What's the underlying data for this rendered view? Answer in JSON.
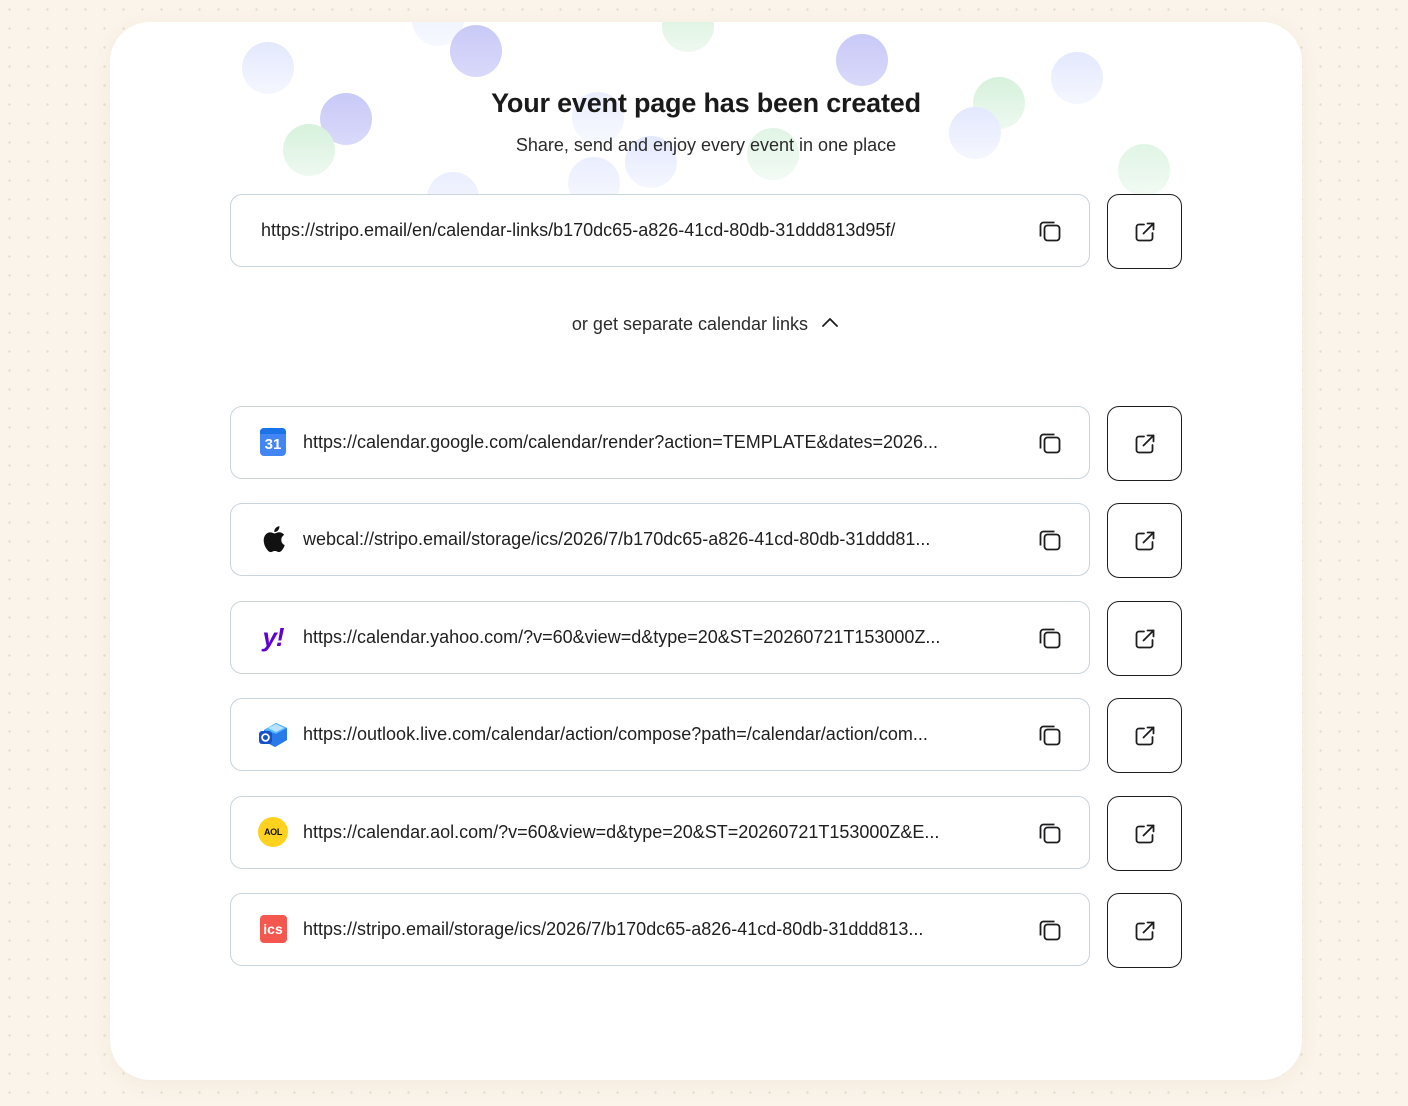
{
  "header": {
    "title": "Your event page has been created",
    "subtitle": "Share, send and enjoy every event in one place"
  },
  "main_link": {
    "url": "https://stripo.email/en/calendar-links/b170dc65-a826-41cd-80db-31ddd813d95f/"
  },
  "toggle": {
    "label": "or get separate calendar links"
  },
  "calendar_links": [
    {
      "service": "google-calendar",
      "icon": "google-calendar-icon",
      "icon_text": "31",
      "url": "https://calendar.google.com/calendar/render?action=TEMPLATE&dates=2026..."
    },
    {
      "service": "apple-calendar",
      "icon": "apple-icon",
      "icon_text": "",
      "url": "webcal://stripo.email/storage/ics/2026/7/b170dc65-a826-41cd-80db-31ddd81..."
    },
    {
      "service": "yahoo-calendar",
      "icon": "yahoo-icon",
      "icon_text": "y!",
      "url": "https://calendar.yahoo.com/?v=60&view=d&type=20&ST=20260721T153000Z..."
    },
    {
      "service": "outlook-calendar",
      "icon": "outlook-icon",
      "icon_text": "",
      "url": "https://outlook.live.com/calendar/action/compose?path=/calendar/action/com..."
    },
    {
      "service": "aol-calendar",
      "icon": "aol-icon",
      "icon_text": "AOL",
      "url": "https://calendar.aol.com/?v=60&view=d&type=20&ST=20260721T153000Z&E..."
    },
    {
      "service": "ics-file",
      "icon": "ics-icon",
      "icon_text": "ics",
      "url": "https://stripo.email/storage/ics/2026/7/b170dc65-a826-41cd-80db-31ddd813..."
    }
  ],
  "colors": {
    "background": "#fbf4ea",
    "card": "#ffffff",
    "field_border": "#c9d4dc",
    "button_border": "#1d1d1f",
    "google_blue": "#4285f4",
    "yahoo_purple": "#6001d2",
    "aol_yellow": "#ffd21f",
    "ics_red": "#f4574d"
  }
}
